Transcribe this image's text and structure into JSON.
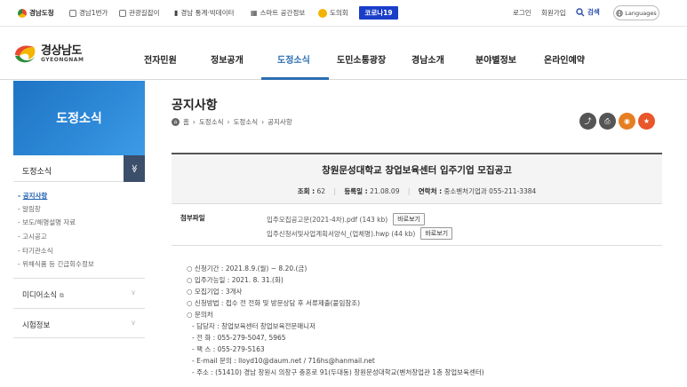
{
  "topbar": {
    "site": "경남도청",
    "links": [
      "경남1번가",
      "관광길잡이",
      "경남 통계·빅데이터",
      "스마트 공간정보",
      "도의회"
    ],
    "corona": "코로나19",
    "login": "로그인",
    "join": "회원가입",
    "search": "검색",
    "languages": "Languages"
  },
  "logo": {
    "ko": "경상남도",
    "en": "GYEONGNAM"
  },
  "gnb": [
    "전자민원",
    "정보공개",
    "도정소식",
    "도민소통광장",
    "경남소개",
    "분야별정보",
    "온라인예약"
  ],
  "sidebar": {
    "title": "도정소식",
    "menu_label": "도정소식",
    "toggle": "≫",
    "sub_items": [
      "공지사항",
      "알림창",
      "보도/해명설명 자료",
      "고시공고",
      "타기관소식",
      "위해식품 등 긴급회수정보"
    ],
    "groups": [
      "미디어소식",
      "시험정보"
    ]
  },
  "content": {
    "title": "공지사항",
    "breadcrumb": [
      "홈",
      "도정소식",
      "도정소식",
      "공지사항"
    ],
    "post_title": "창원문성대학교 창업보육센터 입주기업 모집공고",
    "views_label": "조회 :",
    "views": "62",
    "date_label": "등록일 :",
    "date": "21.08.09",
    "contact_label": "연락처 :",
    "contact": "중소벤처기업과 055-211-3384",
    "attach_label": "첨부파일",
    "files": [
      {
        "name": "입주모집공고문(2021-4차).pdf (143 kb)",
        "button": "바로보기"
      },
      {
        "name": "입주신청서및사업계획서양식_(업체명).hwp (44 kb)",
        "button": "바로보기"
      }
    ],
    "body": [
      "○ 신청기간 : 2021.8.9.(월) ~ 8.20.(금)",
      "○ 입주가능일 : 2021. 8. 31.(화)",
      "○ 모집기업 : 3개사",
      "○ 신청방법 : 접수 전 전화 및 방문상담 후 서류제출(붙임참조)",
      "○ 문의처",
      "- 담당자 : 창업보육센터 창업보육전문매니저",
      "- 전 화 : 055-279-5047, 5965",
      "- 팩 스 : 055-279-5163",
      "- E-mail 문의 : lloyd10@daum.net / 716hs@hanmail.net",
      "- 주소 : (51410) 경남 창원시 의창구 충혼로 91(두대동) 창원문성대학교(벤처창업관 1층 창업보육센터)"
    ]
  },
  "colors": {
    "accent": "#2a6db0",
    "corona": "#1a3ec9",
    "lnb": "#1f74c4"
  }
}
